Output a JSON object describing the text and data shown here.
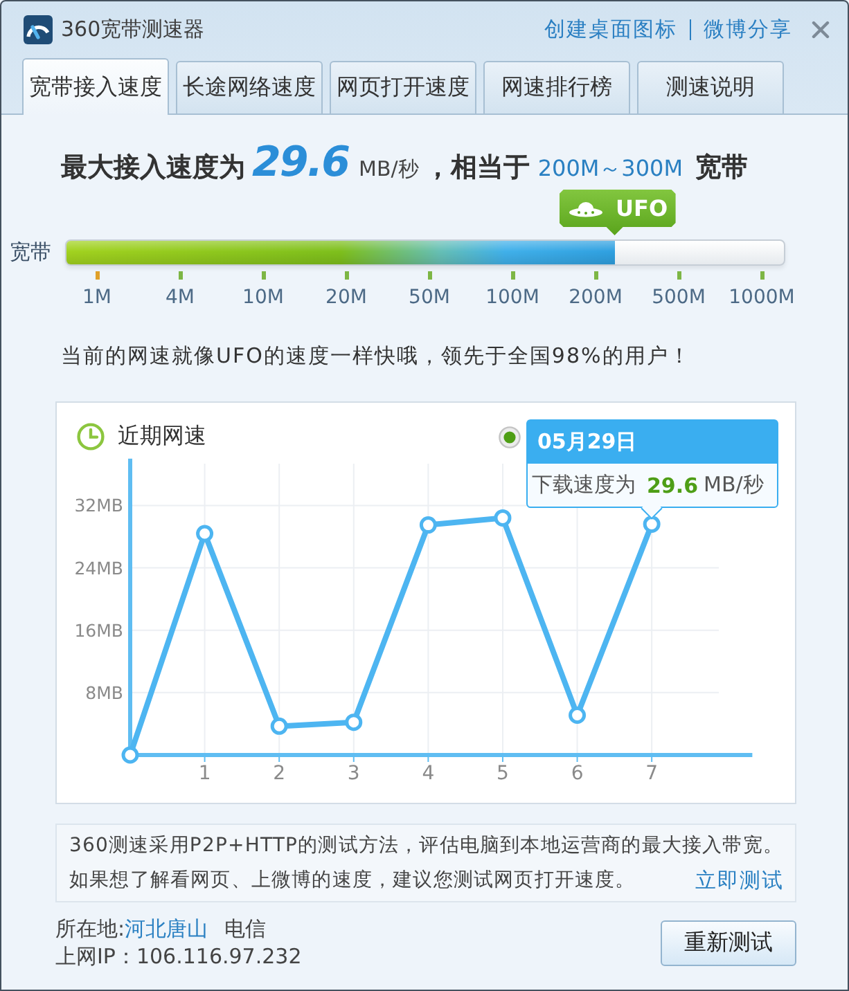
{
  "window": {
    "title": "360宽带测速器",
    "links": [
      "创建桌面图标",
      "微博分享"
    ]
  },
  "tabs": [
    {
      "label": "宽带接入速度",
      "selected": true
    },
    {
      "label": "长途网络速度",
      "selected": false
    },
    {
      "label": "网页打开速度",
      "selected": false
    },
    {
      "label": "网速排行榜",
      "selected": false
    },
    {
      "label": "测速说明",
      "selected": false
    }
  ],
  "result": {
    "label": "最大接入速度为",
    "speed": "29.6",
    "unit": "MB/秒",
    "comparison": "，相当于",
    "range": "200M～300M",
    "range_suffix": "宽带"
  },
  "meter": {
    "label": "宽带",
    "badge": "UFO",
    "level": 0.765,
    "ticks": [
      {
        "label": "1M",
        "color": "#e0a029"
      },
      {
        "label": "4M",
        "color": "#7db645"
      },
      {
        "label": "10M",
        "color": "#7db645"
      },
      {
        "label": "20M",
        "color": "#7db645"
      },
      {
        "label": "50M",
        "color": "#7db645"
      },
      {
        "label": "100M",
        "color": "#7db645"
      },
      {
        "label": "200M",
        "color": "#7db645"
      },
      {
        "label": "500M",
        "color": "#7db645"
      },
      {
        "label": "1000M",
        "color": "#7db645"
      }
    ]
  },
  "comment": "当前的网速就像UFO的速度一样快哦，领先于全国98%的用户！",
  "chart": {
    "tooltip": {
      "date": "05月29日",
      "label": "下载速度为",
      "value": "29.6",
      "unit": "MB/秒"
    },
    "chart_data": {
      "type": "line",
      "title": "近期网速",
      "x": [
        0,
        1,
        2,
        3,
        4,
        5,
        6,
        7
      ],
      "series": [
        {
          "color": "#4db5f1",
          "marker": "circle",
          "values": [
            0,
            28.4,
            3.7,
            4.2,
            29.5,
            30.4,
            5.1,
            29.6
          ]
        }
      ],
      "xlim": [
        0,
        8.35
      ],
      "ylim": [
        0,
        38
      ],
      "xticks": [
        1,
        2,
        3,
        4,
        5,
        6,
        7
      ],
      "yticks": [
        {
          "value": 8,
          "label": "8MB"
        },
        {
          "value": 16,
          "label": "16MB"
        },
        {
          "value": 24,
          "label": "24MB"
        },
        {
          "value": 32,
          "label": "32MB"
        }
      ],
      "grid": true
    }
  },
  "info": {
    "lines": [
      "360测速采用P2P+HTTP的测试方法，评估电脑到本地运营商的最大接入带宽。",
      "如果想了解看网页、上微博的速度，建议您测试网页打开速度。"
    ],
    "link": "立即测试"
  },
  "location": {
    "label": "所在地:",
    "place": "河北唐山",
    "isp": "电信",
    "ip": "上网IP：106.116.97.232"
  },
  "retest_button": "重新测试"
}
